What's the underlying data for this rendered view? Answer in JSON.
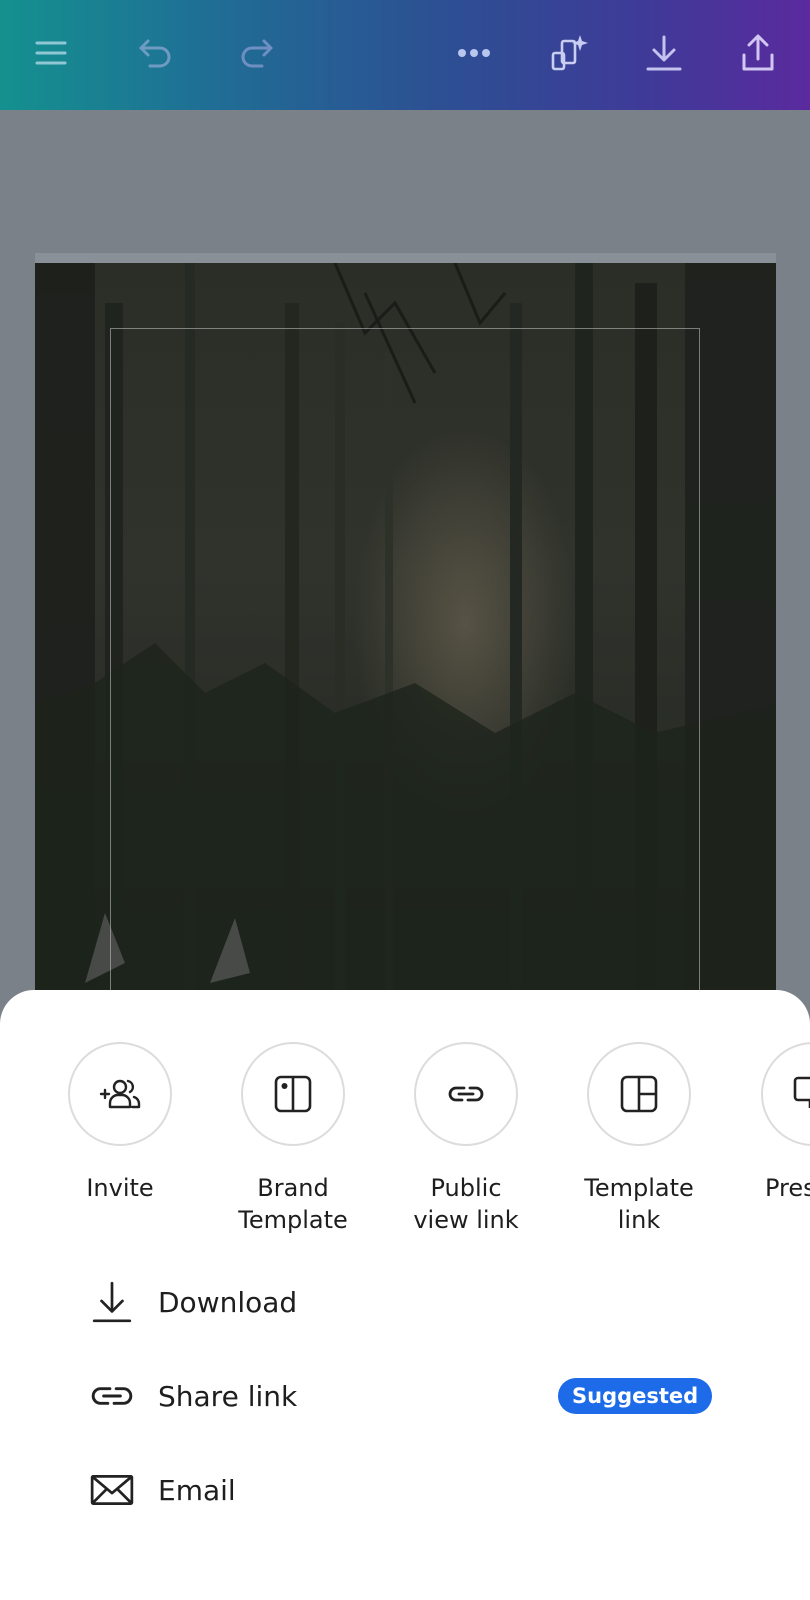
{
  "toolbar": {
    "icons": [
      "menu-icon",
      "undo-icon",
      "redo-icon",
      "more-icon",
      "magic-resize-icon",
      "download-icon",
      "share-icon"
    ],
    "gradient_colors": [
      "#14918f",
      "#2d4f93",
      "#5a2a9e"
    ]
  },
  "share_sheet": {
    "options": [
      {
        "label": "Invite",
        "icon": "invite-people-icon"
      },
      {
        "label": "Brand\nTemplate",
        "icon": "brand-template-icon"
      },
      {
        "label": "Public\nview link",
        "icon": "link-icon"
      },
      {
        "label": "Template\nlink",
        "icon": "template-icon"
      },
      {
        "label": "Pres",
        "icon": "present-icon"
      }
    ],
    "rows": [
      {
        "label": "Download",
        "icon": "download-icon"
      },
      {
        "label": "Share link",
        "icon": "link-icon",
        "badge": "Suggested"
      },
      {
        "label": "Email",
        "icon": "email-icon"
      }
    ],
    "badge_color": "#1d6be8"
  }
}
